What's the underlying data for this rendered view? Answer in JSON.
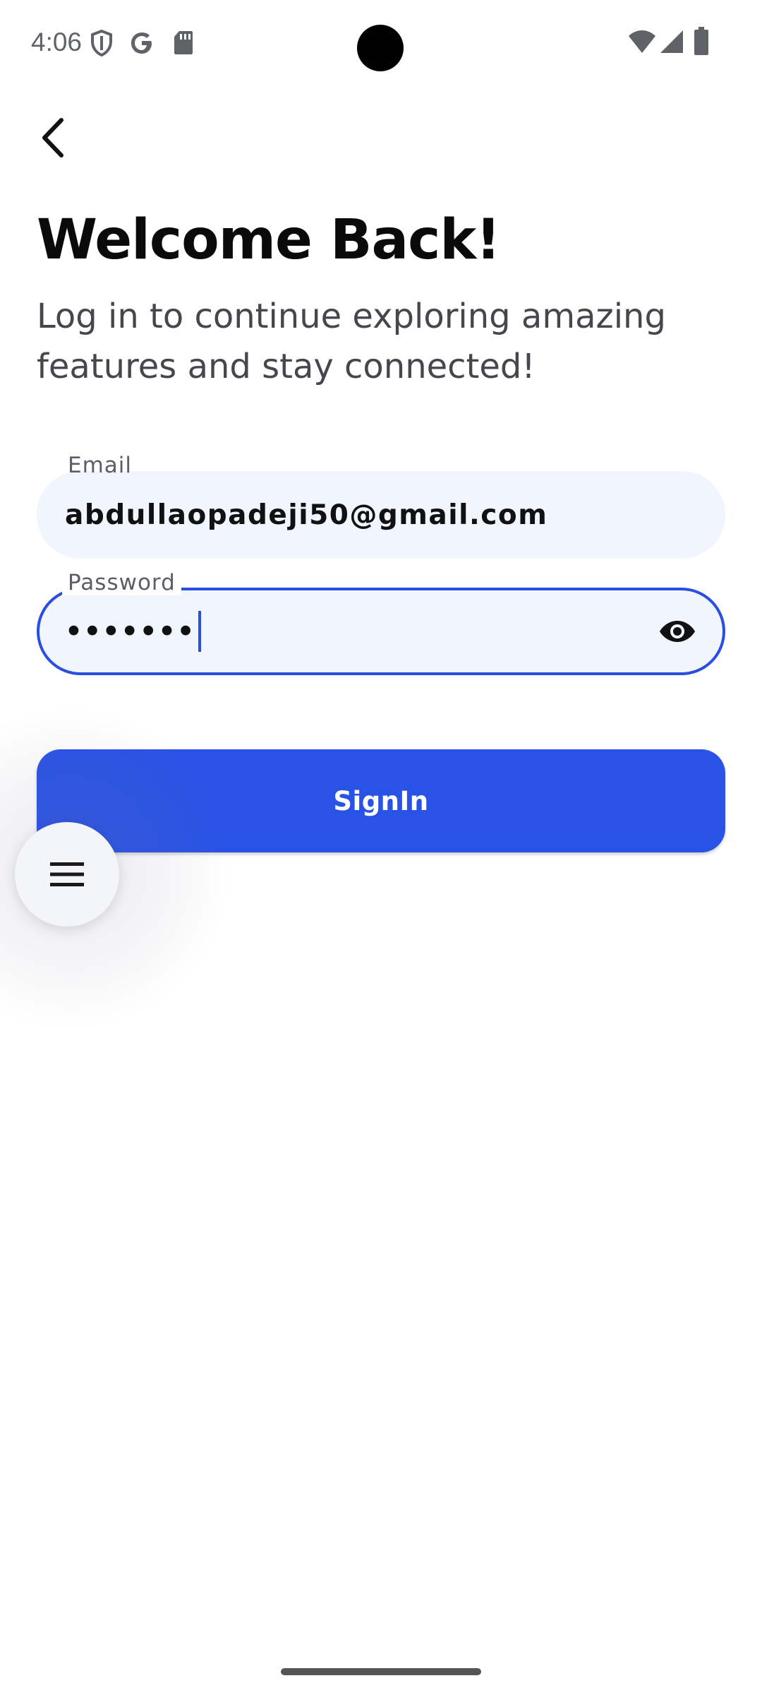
{
  "status_bar": {
    "time": "4:06",
    "icons": [
      "shield-icon",
      "google-icon",
      "sd-card-icon",
      "wifi-icon",
      "cellular-signal-icon",
      "battery-icon"
    ]
  },
  "header": {
    "back_icon": "chevron-left-icon",
    "title": "Welcome Back!",
    "subtitle": "Log in to continue exploring amazing features and stay connected!"
  },
  "form": {
    "email": {
      "label": "Email",
      "value": "abdullaopadeji50@gmail.com"
    },
    "password": {
      "label": "Password",
      "value": "•••••••",
      "toggle_icon": "eye-icon",
      "focused": true
    },
    "submit_label": "SignIn"
  },
  "fab": {
    "icon": "menu-icon"
  },
  "colors": {
    "primary": "#2952e6",
    "field_background": "#f1f5fd",
    "focus_border": "#2a4fe0",
    "title_text": "#0a0a0a",
    "subtitle_text": "#45474d"
  }
}
